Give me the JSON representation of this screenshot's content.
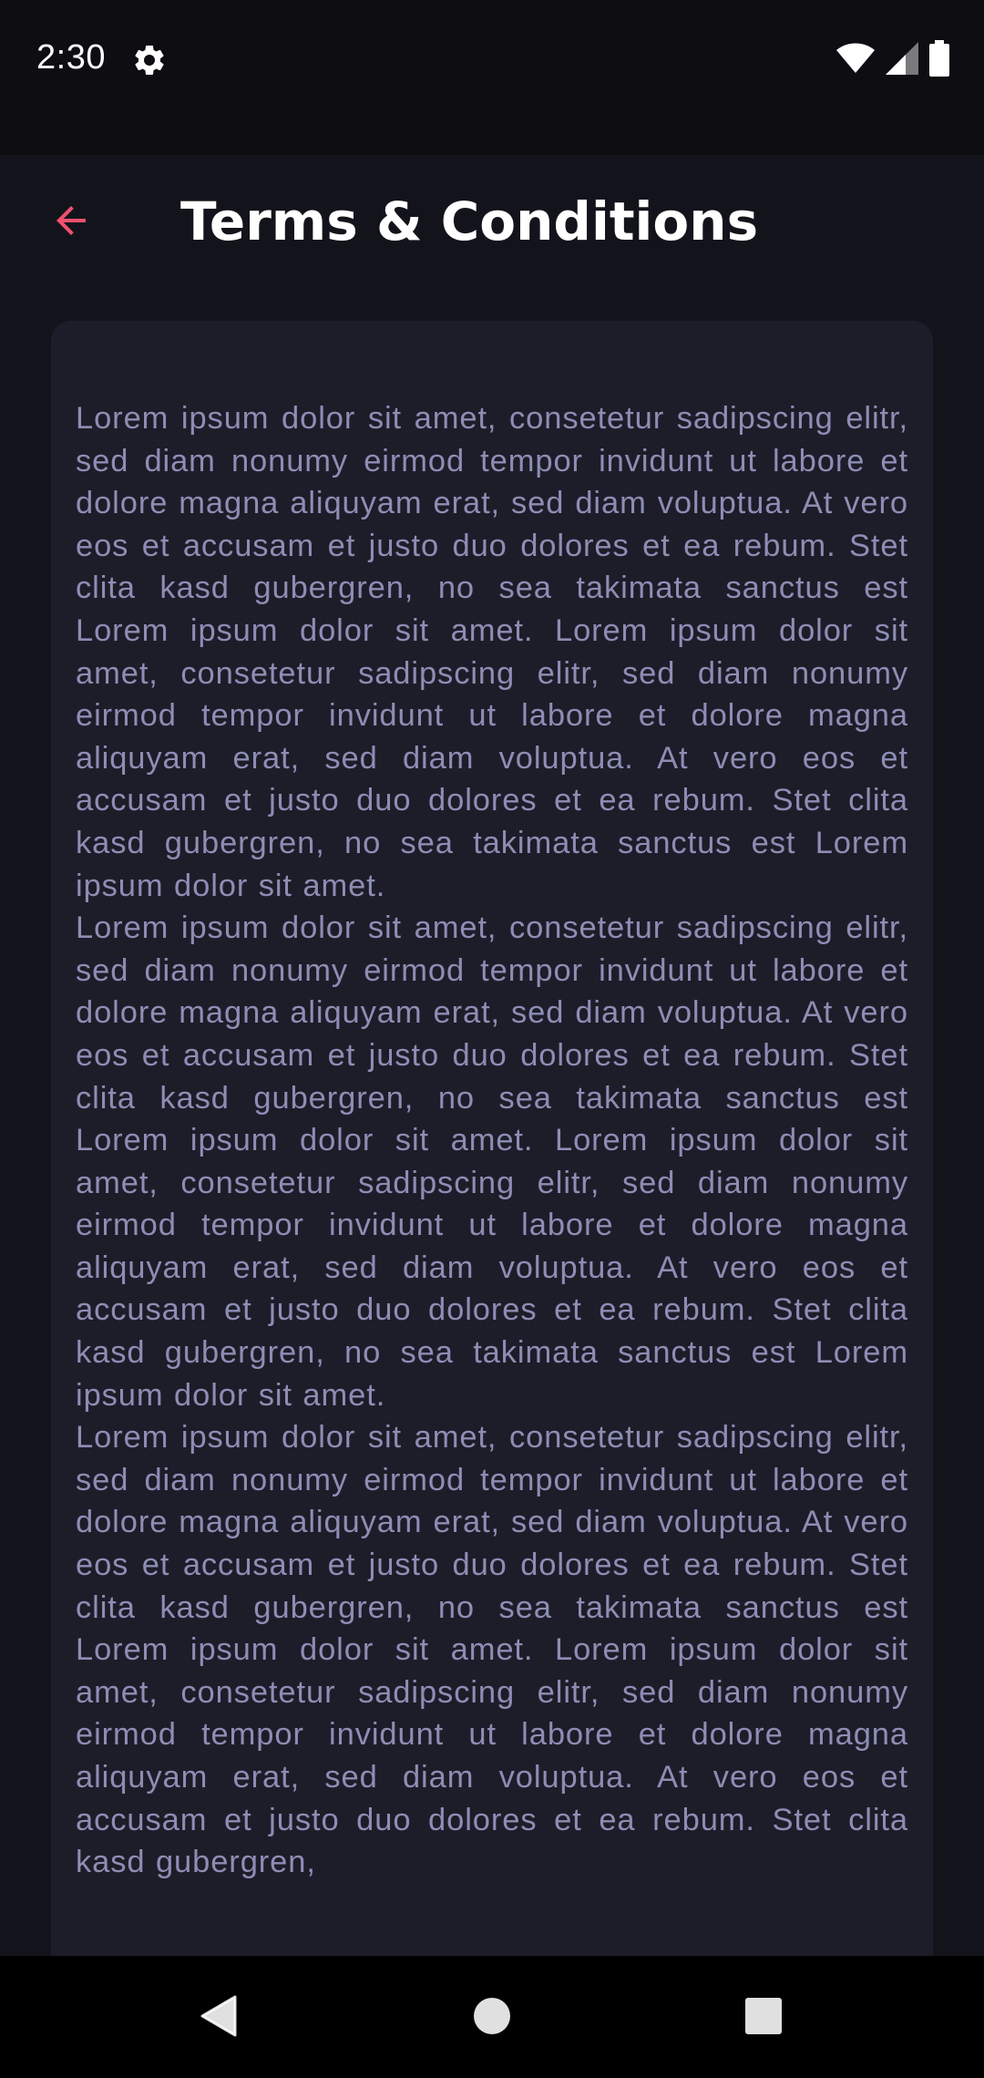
{
  "status_bar": {
    "time": "2:30",
    "icons": [
      "gear-icon",
      "wifi-icon",
      "signal-icon",
      "battery-icon"
    ]
  },
  "app_bar": {
    "title": "Terms & Conditions",
    "back_icon": "arrow-left-icon",
    "accent_color": "#f0506e"
  },
  "content": {
    "paragraphs": [
      "Lorem ipsum dolor sit amet, consetetur sadipscing elitr, sed diam nonumy eirmod tempor invidunt ut labore et dolore magna aliquyam erat, sed diam voluptua. At vero eos et accusam et justo duo dolores et ea rebum. Stet clita kasd gubergren, no sea takimata sanctus est Lorem ipsum dolor sit amet. Lorem ipsum dolor sit amet, consetetur sadipscing elitr, sed diam nonumy eirmod tempor invidunt ut labore et dolore magna aliquyam erat, sed diam voluptua. At vero eos et accusam et justo duo dolores et ea rebum. Stet clita kasd gubergren, no sea takimata sanctus est Lorem ipsum dolor sit amet.",
      "Lorem ipsum dolor sit amet, consetetur sadipscing elitr, sed diam nonumy eirmod tempor invidunt ut labore et dolore magna aliquyam erat, sed diam voluptua. At vero eos et accusam et justo duo dolores et ea rebum. Stet clita kasd gubergren, no sea takimata sanctus est Lorem ipsum dolor sit amet. Lorem ipsum dolor sit amet, consetetur sadipscing elitr, sed diam nonumy eirmod tempor invidunt ut labore et dolore magna aliquyam erat, sed diam voluptua. At vero eos et accusam et justo duo dolores et ea rebum. Stet clita kasd gubergren, no sea takimata sanctus est Lorem ipsum dolor sit amet.",
      "Lorem ipsum dolor sit amet, consetetur sadipscing elitr, sed diam nonumy eirmod tempor invidunt ut labore et dolore magna aliquyam erat, sed diam voluptua. At vero eos et accusam et justo duo dolores et ea rebum. Stet clita kasd gubergren, no sea takimata sanctus est Lorem ipsum dolor sit amet. Lorem ipsum dolor sit amet, consetetur sadipscing elitr, sed diam nonumy eirmod tempor invidunt ut labore et dolore magna aliquyam erat, sed diam voluptua. At vero eos et accusam et justo duo dolores et ea rebum. Stet clita kasd gubergren,"
    ]
  },
  "nav_bar": {
    "buttons": [
      "back-triangle-icon",
      "home-circle-icon",
      "recents-square-icon"
    ]
  }
}
